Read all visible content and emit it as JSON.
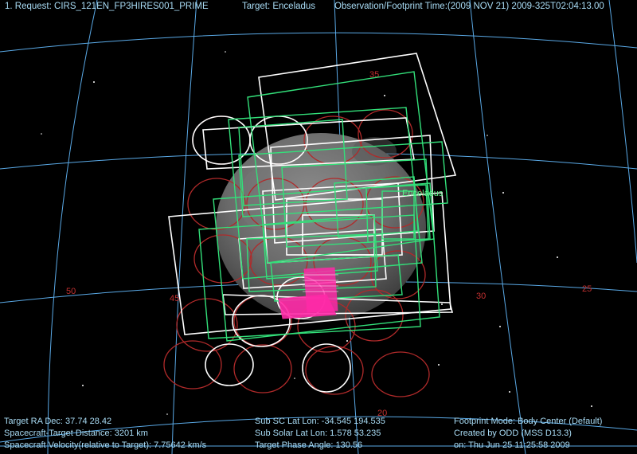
{
  "header": {
    "request": "1. Request: CIRS_121EN_FP3HIRES001_PRIME",
    "target": "Target: Enceladus",
    "observation_time": "Observation/Footprint Time:(2009 NOV 21) 2009-325T02:04:13.00"
  },
  "grid_labels": {
    "dec_35": "35",
    "dec_20": "20",
    "ra_50": "50",
    "ra_45": "45",
    "ra_30": "30",
    "ra_25": "25"
  },
  "body_label": "Enceladus",
  "footer": {
    "target_ra_dec": "Target RA Dec: 37.74  28.42",
    "sc_target_distance": "Spacecraft-Target Distance:     3201 km",
    "sc_velocity": "Spacecraft Velocity(relative to Target): 7.75642 km/s",
    "sub_sc_lat_lon": "Sub SC Lat Lon: -34.545  194.535",
    "sub_solar_lat_lon": "Sub Solar Lat Lon:  1.578  53.235",
    "target_phase_angle": "Target Phase Angle: 130.56",
    "footprint_mode": "Footprint Mode: Body Center (Default)",
    "created_by": "Created by ODD (MSS D13.3)",
    "created_on": "on: Thu Jun 25 11:25:58 2009"
  },
  "colors": {
    "background": "#000000",
    "grid": "#5aa9e6",
    "grid_label": "#c23030",
    "white_footprint": "#ffffff",
    "green_footprint": "#33e07a",
    "red_circle": "#b02a2a",
    "pink_footprint": "#ff2aa8",
    "text": "#a9dcf5",
    "body_label": "#5ef08a"
  }
}
